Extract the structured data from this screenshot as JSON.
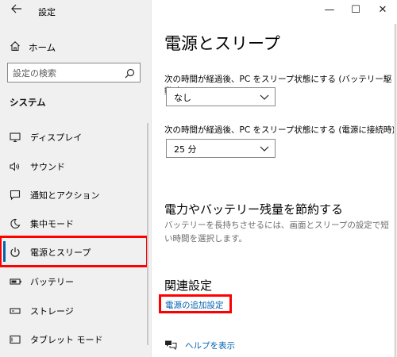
{
  "window": {
    "title": "設定",
    "controls": {
      "minimize": "—",
      "maximize": "☐",
      "close": "✕"
    }
  },
  "sidebar": {
    "home_label": "ホーム",
    "search_placeholder": "設定の検索",
    "section_title": "システム",
    "items": [
      {
        "label": "ディスプレイ",
        "icon": "display-icon",
        "selected": false
      },
      {
        "label": "サウンド",
        "icon": "sound-icon",
        "selected": false
      },
      {
        "label": "通知とアクション",
        "icon": "notification-icon",
        "selected": false
      },
      {
        "label": "集中モード",
        "icon": "moon-icon",
        "selected": false
      },
      {
        "label": "電源とスリープ",
        "icon": "power-icon",
        "selected": true
      },
      {
        "label": "バッテリー",
        "icon": "battery-icon",
        "selected": false
      },
      {
        "label": "ストレージ",
        "icon": "storage-icon",
        "selected": false
      },
      {
        "label": "タブレット モード",
        "icon": "tablet-icon",
        "selected": false
      }
    ]
  },
  "main": {
    "title": "電源とスリープ",
    "sleep_battery_label": "次の時間が経過後、PC をスリープ状態にする (バッテリー駆動時)",
    "sleep_battery_value": "なし",
    "sleep_plugged_label": "次の時間が経過後、PC をスリープ状態にする (電源に接続時)",
    "sleep_plugged_value": "25 分",
    "save_heading": "電力やバッテリー残量を節約する",
    "save_desc": "バッテリーを長持ちさせるには、画面とスリープの設定で短い時間を選択します。",
    "related_heading": "関連設定",
    "additional_power_link": "電源の追加設定",
    "help_link": "ヘルプを表示"
  },
  "colors": {
    "highlight": "#ff0000",
    "link": "#0063b1",
    "sidebar_bg": "#f0f0f0"
  }
}
